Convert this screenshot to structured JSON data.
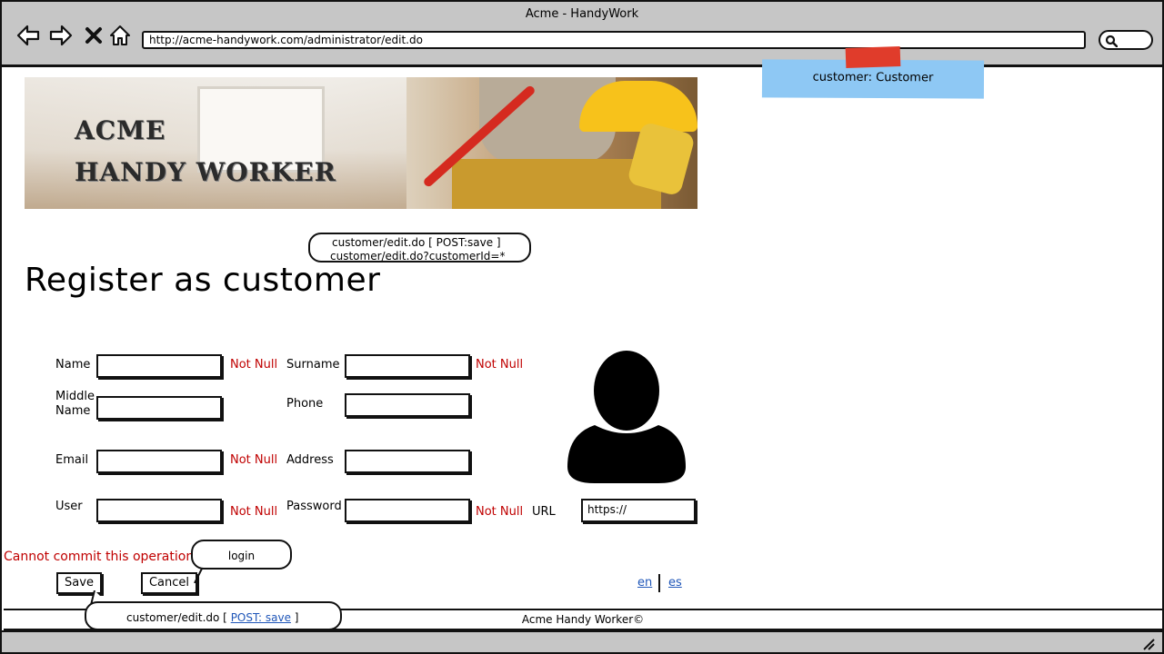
{
  "window": {
    "title": "Acme - HandyWork"
  },
  "browser": {
    "url": "http://acme-handywork.com/administrator/edit.do",
    "icons": [
      "back-arrow-icon",
      "forward-arrow-icon",
      "close-icon",
      "home-icon",
      "search-icon"
    ]
  },
  "sticky_note": {
    "text": "customer: Customer"
  },
  "banner": {
    "line1": "ACME",
    "line2": "HANDY WORKER"
  },
  "callouts": {
    "top_line1": "customer/edit.do [ POST:save ]",
    "top_line2": "customer/edit.do?customerId=*",
    "login": "login",
    "bottom_prefix": "customer/edit.do [ ",
    "bottom_link": "POST: save",
    "bottom_suffix": " ]"
  },
  "page": {
    "title": "Register as customer"
  },
  "form": {
    "name_label": "Name",
    "surname_label": "Surname",
    "middle_name_label_1": "Middle",
    "middle_name_label_2": "Name",
    "phone_label": "Phone",
    "email_label": "Email",
    "address_label": "Address",
    "user_label": "User",
    "password_label": "Password",
    "url_label": "URL",
    "url_value": "https://",
    "not_null": "Not Null"
  },
  "error_message": "Cannot commit this operation",
  "buttons": {
    "save": "Save",
    "cancel": "Cancel"
  },
  "languages": {
    "en": "en",
    "es": "es"
  },
  "footer": {
    "text": "Acme Handy Worker©"
  },
  "colors": {
    "chrome": "#c6c6c6",
    "error": "#c00000",
    "link": "#1f56b8",
    "sticky": "#8ec8f4",
    "tape": "#e03c2b"
  }
}
